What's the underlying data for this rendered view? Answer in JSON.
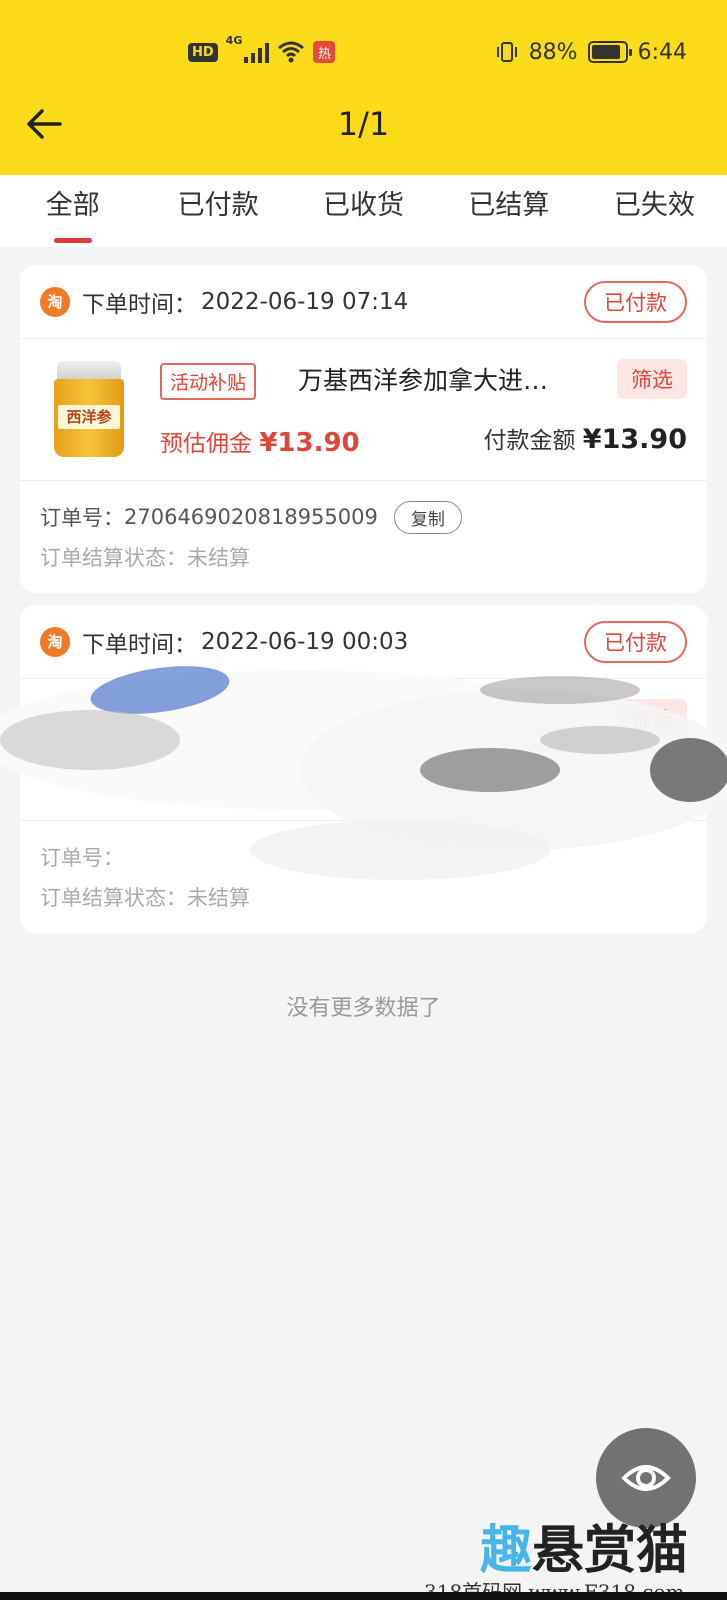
{
  "status_bar": {
    "hd": "HD",
    "network": "4G",
    "notif": "热",
    "battery_text": "88%",
    "battery_level": 0.88,
    "time": "6:44"
  },
  "header": {
    "title": "1/1"
  },
  "tabs": [
    {
      "label": "全部",
      "active": true
    },
    {
      "label": "已付款"
    },
    {
      "label": "已收货"
    },
    {
      "label": "已结算"
    },
    {
      "label": "已失效"
    }
  ],
  "orders": [
    {
      "platform_icon": "淘",
      "time_label": "下单时间：",
      "time": "2022-06-19 07:14",
      "status": "已付款",
      "product": {
        "thumb_text": "西洋参",
        "tag": "活动补贴",
        "title": "万基西洋参加拿大进…",
        "filter": "筛选",
        "commission_label": "预估佣金",
        "commission": "¥13.90",
        "pay_label": "付款金额",
        "pay": "¥13.90"
      },
      "order_no_label": "订单号：",
      "order_no": "2706469020818955009",
      "copy_label": "复制",
      "settle_label": "订单结算状态：",
      "settle_value": "未结算"
    },
    {
      "platform_icon": "淘",
      "time_label": "下单时间：",
      "time": "2022-06-19 00:03",
      "status": "已付款",
      "product": {
        "filter": "筛选"
      },
      "order_no_label": "订单号：",
      "settle_label": "订单结算状态：",
      "settle_value": "未结算"
    }
  ],
  "no_more": "没有更多数据了",
  "fab_icon": "eye-icon",
  "watermark": {
    "big_a": "趣",
    "big_b": "悬赏猫",
    "small": "318首码网 www.F318.com"
  },
  "colors": {
    "header_bg": "#fbdb1a",
    "accent_red": "#e0453a",
    "page_bg": "#f4f4f4"
  }
}
